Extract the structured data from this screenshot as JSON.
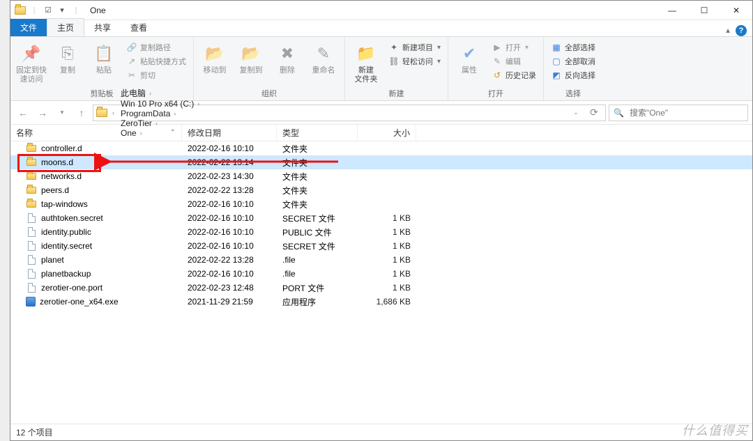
{
  "title": "One",
  "winControls": {
    "min": "—",
    "max": "☐",
    "close": "✕"
  },
  "qat": {
    "check": "☑",
    "dropdown": "▾"
  },
  "tabs": {
    "file": "文件",
    "home": "主页",
    "share": "共享",
    "view": "查看"
  },
  "ribbon": {
    "clipboard": {
      "label": "剪贴板",
      "pin": "固定到快\n速访问",
      "copy": "复制",
      "paste": "粘贴",
      "copyPath": "复制路径",
      "pasteShortcut": "粘贴快捷方式",
      "cut": "剪切"
    },
    "organize": {
      "label": "组织",
      "moveTo": "移动到",
      "copyTo": "复制到",
      "delete": "删除",
      "rename": "重命名"
    },
    "new": {
      "label": "新建",
      "newFolder": "新建\n文件夹",
      "newItem": "新建项目",
      "easyAccess": "轻松访问"
    },
    "open": {
      "label": "打开",
      "properties": "属性",
      "open": "打开",
      "edit": "编辑",
      "history": "历史记录"
    },
    "select": {
      "label": "选择",
      "selectAll": "全部选择",
      "selectNone": "全部取消",
      "invert": "反向选择"
    }
  },
  "breadcrumbs": [
    "此电脑",
    "Win 10 Pro x64 (C:)",
    "ProgramData",
    "ZeroTier",
    "One"
  ],
  "search": {
    "placeholder": "搜索\"One\""
  },
  "columns": {
    "name": "名称",
    "date": "修改日期",
    "type": "类型",
    "size": "大小"
  },
  "files": [
    {
      "name": "controller.d",
      "date": "2022-02-16 10:10",
      "type": "文件夹",
      "size": "",
      "icon": "folder"
    },
    {
      "name": "moons.d",
      "date": "2022-02-22 13:14",
      "type": "文件夹",
      "size": "",
      "icon": "folder",
      "selected": true
    },
    {
      "name": "networks.d",
      "date": "2022-02-23 14:30",
      "type": "文件夹",
      "size": "",
      "icon": "folder"
    },
    {
      "name": "peers.d",
      "date": "2022-02-22 13:28",
      "type": "文件夹",
      "size": "",
      "icon": "folder"
    },
    {
      "name": "tap-windows",
      "date": "2022-02-16 10:10",
      "type": "文件夹",
      "size": "",
      "icon": "folder"
    },
    {
      "name": "authtoken.secret",
      "date": "2022-02-16 10:10",
      "type": "SECRET 文件",
      "size": "1 KB",
      "icon": "file"
    },
    {
      "name": "identity.public",
      "date": "2022-02-16 10:10",
      "type": "PUBLIC 文件",
      "size": "1 KB",
      "icon": "file"
    },
    {
      "name": "identity.secret",
      "date": "2022-02-16 10:10",
      "type": "SECRET 文件",
      "size": "1 KB",
      "icon": "file"
    },
    {
      "name": "planet",
      "date": "2022-02-22 13:28",
      "type": ".file",
      "size": "1 KB",
      "icon": "file"
    },
    {
      "name": "planetbackup",
      "date": "2022-02-16 10:10",
      "type": ".file",
      "size": "1 KB",
      "icon": "file"
    },
    {
      "name": "zerotier-one.port",
      "date": "2022-02-23 12:48",
      "type": "PORT 文件",
      "size": "1 KB",
      "icon": "file"
    },
    {
      "name": "zerotier-one_x64.exe",
      "date": "2021-11-29 21:59",
      "type": "应用程序",
      "size": "1,686 KB",
      "icon": "exe"
    }
  ],
  "status": "12 个项目",
  "watermark": "什么值得买"
}
